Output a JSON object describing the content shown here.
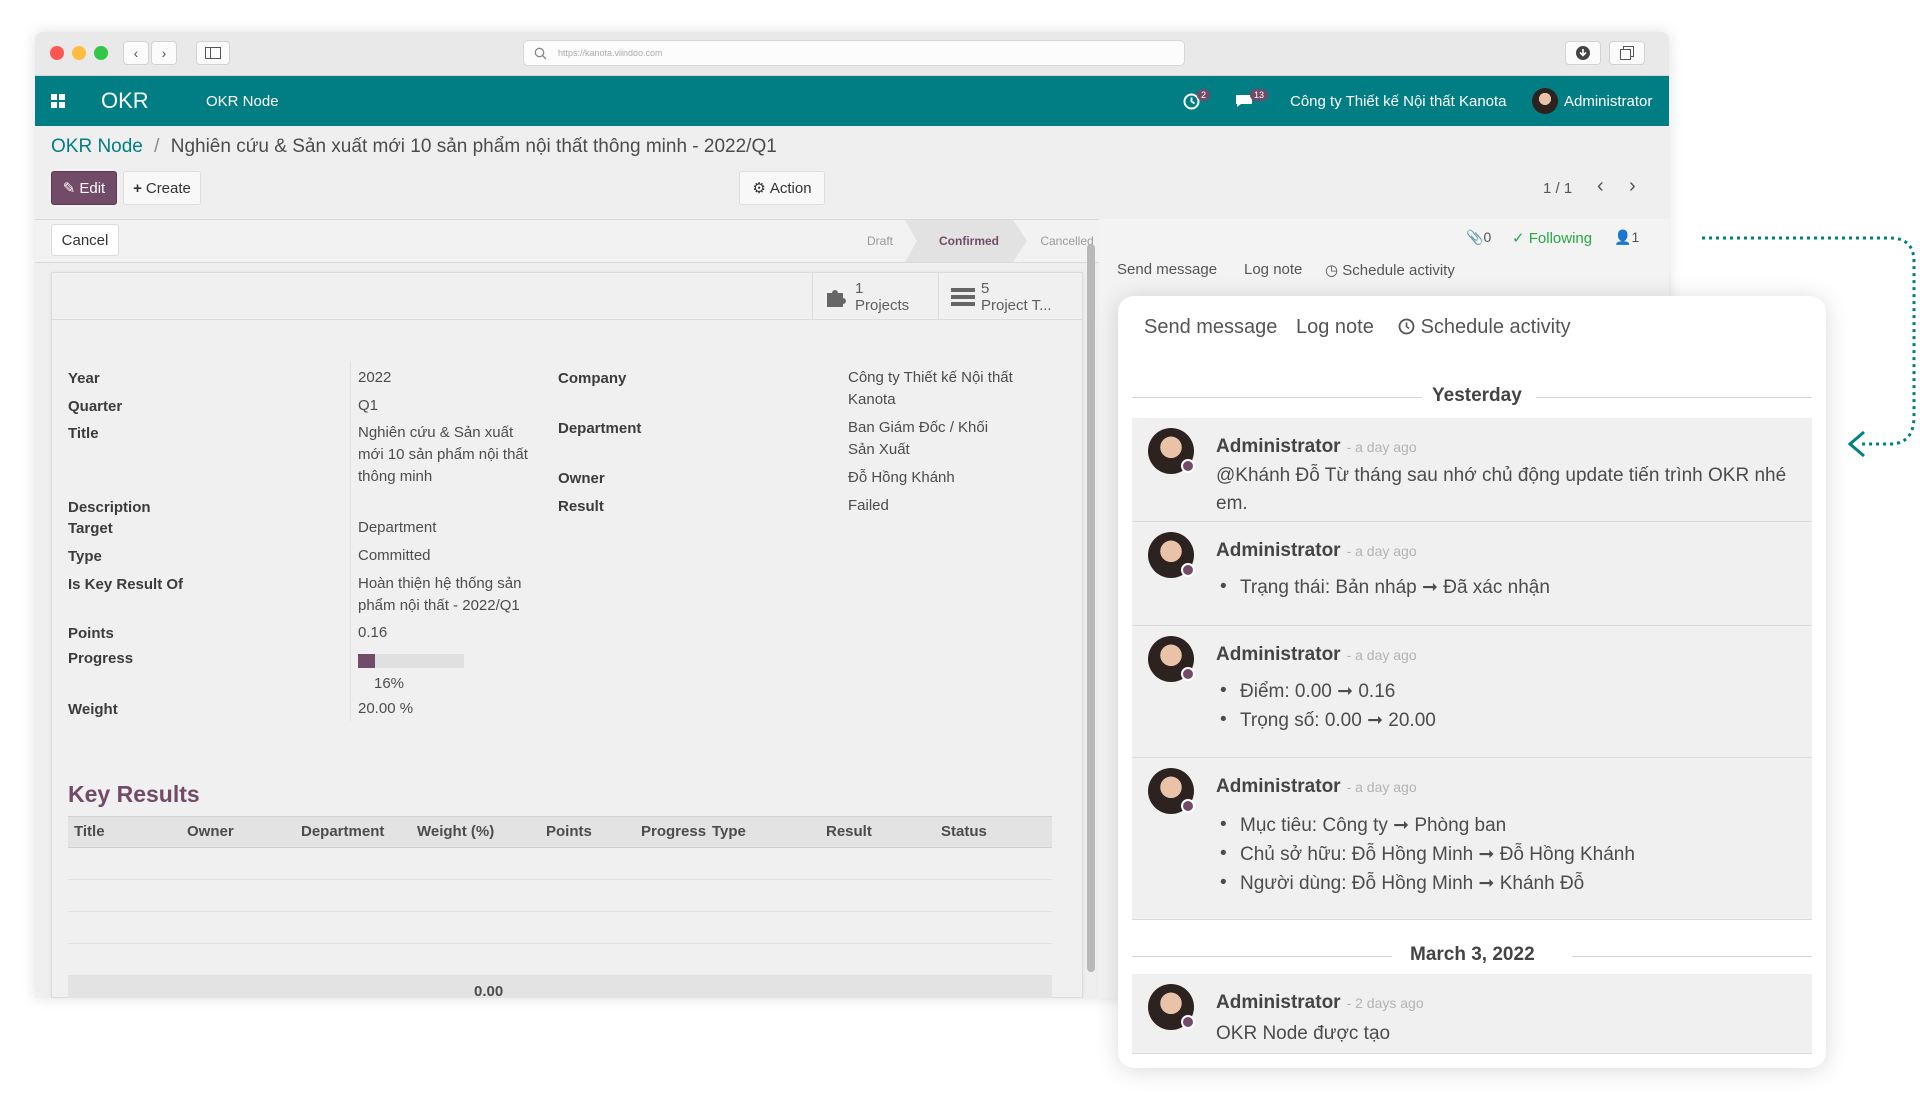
{
  "browser": {
    "url": "https://kanota.viindoo.com"
  },
  "navbar": {
    "app_name": "OKR",
    "menu": "OKR Node",
    "activity_count": "2",
    "message_count": "13",
    "company": "Công ty Thiết kế Nội thất Kanota",
    "user": "Administrator",
    "color": "#017e84"
  },
  "breadcrumb": {
    "parent": "OKR Node",
    "separator": "/",
    "current": "Nghiên cứu & Sản xuất mới 10 sản phẩm nội thất thông minh - 2022/Q1"
  },
  "toolbar": {
    "edit": "Edit",
    "create": "Create",
    "action": "Action",
    "pager": "1 / 1",
    "cancel": "Cancel"
  },
  "stages": [
    "Draft",
    "Confirmed",
    "Cancelled"
  ],
  "active_stage": "Confirmed",
  "chatter_top": {
    "attachments": "0",
    "following": "Following",
    "followers": "1",
    "send_message": "Send message",
    "log_note": "Log note",
    "schedule_activity": "Schedule activity"
  },
  "smart_buttons": [
    {
      "count": "1",
      "label": "Projects",
      "icon": "puzzle-icon"
    },
    {
      "count": "5",
      "label": "Project T...",
      "icon": "tasks-icon"
    }
  ],
  "form": {
    "left": {
      "year_label": "Year",
      "year": "2022",
      "quarter_label": "Quarter",
      "quarter": "Q1",
      "title_label": "Title",
      "title": "Nghiên cứu & Sản xuất mới 10 sản phẩm nội thất thông minh",
      "description_label": "Description",
      "target_label": "Target",
      "target": "Department",
      "type_label": "Type",
      "type": "Committed",
      "key_result_of_label": "Is Key Result Of",
      "key_result_of": "Hoàn thiện hệ thống sản phẩm nội thất - 2022/Q1",
      "points_label": "Points",
      "points": "0.16",
      "progress_label": "Progress",
      "progress": 0.16,
      "progress_text": "16%",
      "weight_label": "Weight",
      "weight": "20.00 %"
    },
    "right": {
      "company_label": "Company",
      "company": "Công ty Thiết kế Nội thất Kanota",
      "department_label": "Department",
      "department": "Ban Giám Đốc / Khối Sản Xuất",
      "owner_label": "Owner",
      "owner": "Đỗ Hồng Khánh",
      "result_label": "Result",
      "result": "Failed"
    }
  },
  "key_results": {
    "title": "Key Results",
    "columns": [
      "Title",
      "Owner",
      "Department",
      "Weight (%)",
      "Points",
      "Progress",
      "Type",
      "Result",
      "Status"
    ],
    "total": "0.00"
  },
  "chatter": {
    "send_message": "Send message",
    "log_note": "Log note",
    "schedule_activity": "Schedule activity",
    "groups": [
      {
        "date": "Yesterday",
        "messages": [
          {
            "author": "Administrator",
            "ago": "- a day ago",
            "text": "@Khánh Đỗ Từ tháng sau nhớ chủ động update tiến trình OKR nhé em."
          },
          {
            "author": "Administrator",
            "ago": "- a day ago",
            "changes": [
              "Trạng thái: Bản nháp ➞ Đã xác nhận"
            ]
          },
          {
            "author": "Administrator",
            "ago": "- a day ago",
            "changes": [
              "Điểm: 0.00 ➞ 0.16",
              "Trọng số: 0.00 ➞ 20.00"
            ]
          },
          {
            "author": "Administrator",
            "ago": "- a day ago",
            "changes": [
              "Mục tiêu: Công ty ➞ Phòng ban",
              "Chủ sở hữu: Đỗ Hồng Minh ➞ Đỗ Hồng Khánh",
              "Người dùng: Đỗ Hồng Minh ➞ Khánh Đỗ"
            ]
          }
        ]
      },
      {
        "date": "March 3, 2022",
        "messages": [
          {
            "author": "Administrator",
            "ago": "- 2 days ago",
            "text": "OKR Node được tạo"
          }
        ]
      }
    ]
  },
  "colors": {
    "primary": "#714b67",
    "teal": "#017e84",
    "following": "#28a745"
  }
}
